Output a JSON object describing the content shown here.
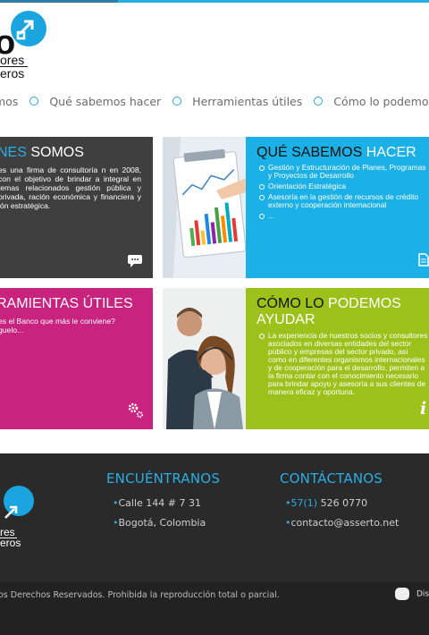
{
  "header": {
    "logo_fragment": "o",
    "logo_line1": "ores",
    "logo_line2": "eros"
  },
  "nav": {
    "items": [
      {
        "label": "mos"
      },
      {
        "label": "Qué sabemos hacer"
      },
      {
        "label": "Herramientas útiles"
      },
      {
        "label": "Cómo lo podemos"
      }
    ]
  },
  "tiles": {
    "quienes": {
      "title_hl": "NES ",
      "title_rest": "SOMOS",
      "text": "es una firma de consultoría n en 2008, con el objetivo de brindar a integral en temas relacionados gestión pública y privada, ración económica y financiera y ión estratégica."
    },
    "que_sabemos": {
      "title_dark": "QUÉ SABEMOS ",
      "title_hl": "HACER",
      "items": [
        "Gestión y Estructuración de Planes, Programas y Proyectos de Desarrollo",
        "Orientación Estratégica",
        "Asesoría en la gestión de recursos de crédito externo y cooperación internacional",
        "..."
      ]
    },
    "herramientas": {
      "title_a": "RAMIENTAS ",
      "title_b": "ÚTILES",
      "text": "es el Banco que más le conviene? guelo..."
    },
    "como": {
      "title_dark": "CÓMO LO ",
      "title_hl": "PODEMOS AYUDAR",
      "items": [
        "La experiencia de nuestros socios y consultores asociados en diversas entidades del sector público y empresas del sector privado, así como en diferentes organismos internacionales y de cooperación para el desarrollo, permiten a la firma contar con el conocimiento necesario para brindar apoyo y asesoría a sus clientes de manera eficaz y oportuna."
      ]
    }
  },
  "footer": {
    "logo_line1": "res",
    "logo_line2": "eros",
    "encuentranos": {
      "title": "ENCUÉNTRANOS",
      "lines": [
        "Calle 144 # 7 31",
        "Bogotá, Colombia"
      ]
    },
    "contactanos": {
      "title": "CONTÁCTANOS",
      "phone_prefix": "57(1)",
      "phone": " 526 0770",
      "email": "contacto@asserto.net"
    },
    "copyright": "os Derechos Reservados. Prohibida la reproducción total o parcial.",
    "credit": "Dis"
  },
  "colors": {
    "accent": "#29aee6",
    "tile_dark": "#3f3f3f",
    "tile_blue": "#1cb1e6",
    "tile_magenta": "#c8237f",
    "tile_green": "#9cc11a",
    "footer": "#2a2a2a"
  },
  "icons": {
    "quienes": "speech-bubble-icon",
    "que_sabemos": "document-icon",
    "herramientas": "gears-icon",
    "como": "info-icon"
  }
}
